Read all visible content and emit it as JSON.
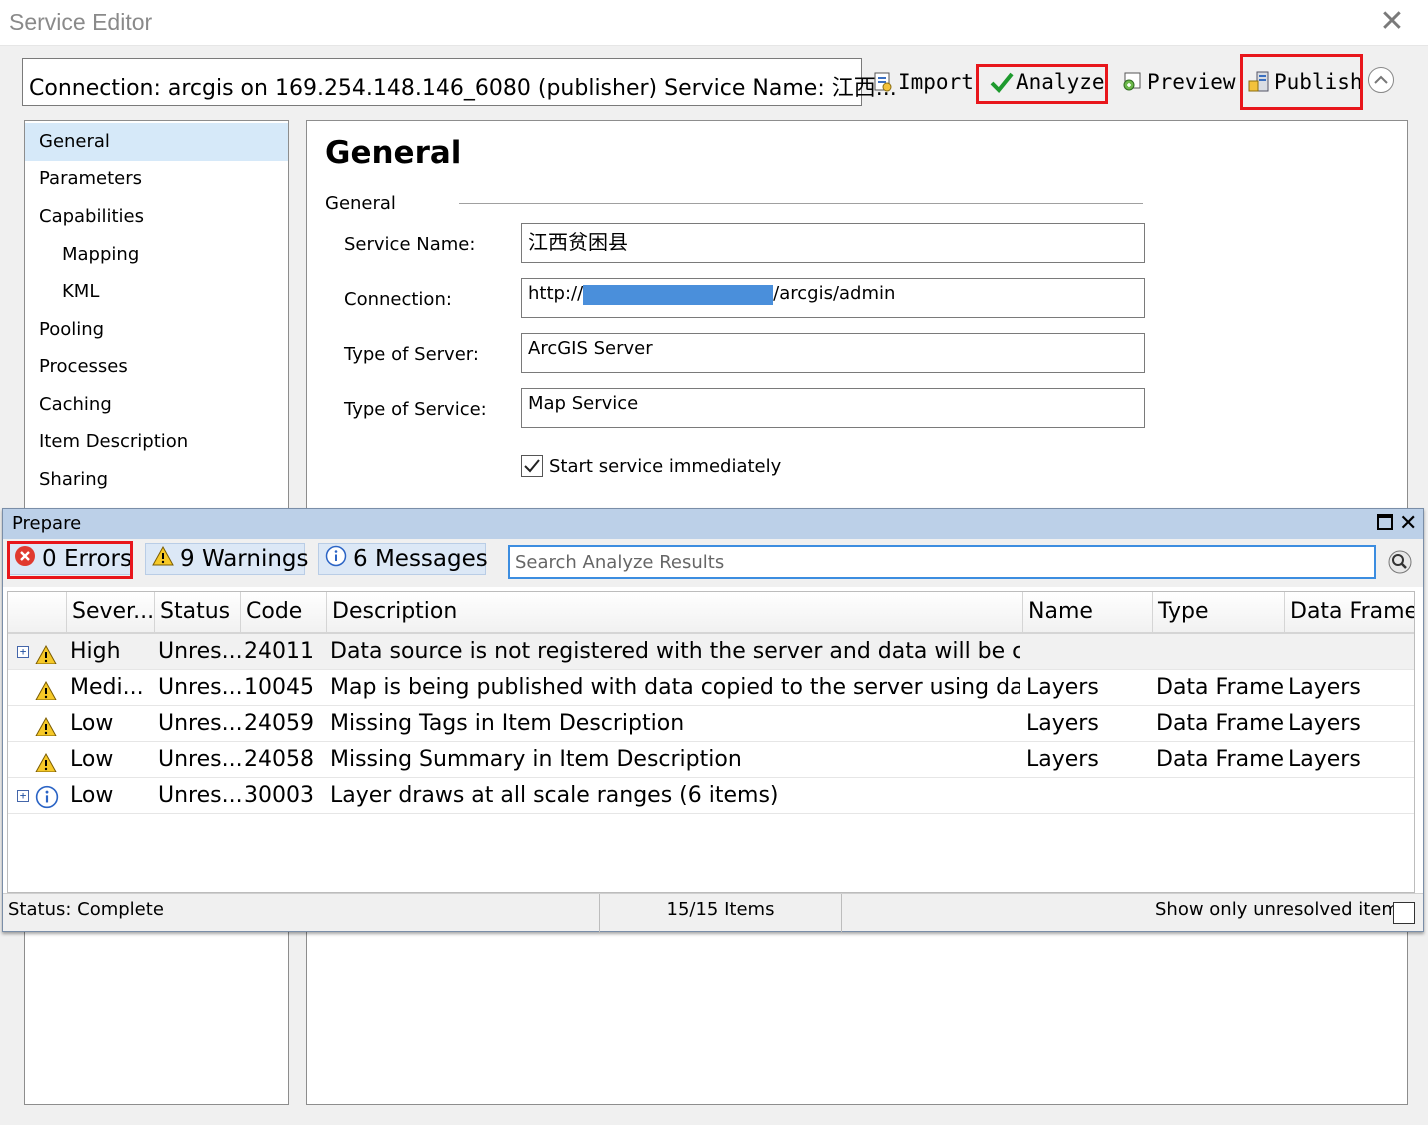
{
  "window": {
    "title": "Service Editor"
  },
  "toolbar": {
    "connection": "Connection: arcgis on 169.254.148.146_6080 (publisher)   Service Name: 江西...",
    "import_label": "Import",
    "analyze_label": "Analyze",
    "preview_label": "Preview",
    "publish_label": "Publish"
  },
  "nav": {
    "items": [
      {
        "label": "General",
        "selected": true,
        "indent": false
      },
      {
        "label": "Parameters",
        "selected": false,
        "indent": false
      },
      {
        "label": "Capabilities",
        "selected": false,
        "indent": false
      },
      {
        "label": "Mapping",
        "selected": false,
        "indent": true
      },
      {
        "label": "KML",
        "selected": false,
        "indent": true
      },
      {
        "label": "Pooling",
        "selected": false,
        "indent": false
      },
      {
        "label": "Processes",
        "selected": false,
        "indent": false
      },
      {
        "label": "Caching",
        "selected": false,
        "indent": false
      },
      {
        "label": "Item Description",
        "selected": false,
        "indent": false
      },
      {
        "label": "Sharing",
        "selected": false,
        "indent": false
      }
    ]
  },
  "general": {
    "heading": "General",
    "group_label": "General",
    "fields": [
      {
        "label": "Service Name:",
        "value": "江西贫困县"
      },
      {
        "label": "Connection:",
        "value_prefix": "http://",
        "value_suffix": "/arcgis/admin"
      },
      {
        "label": "Type of Server:",
        "value": "ArcGIS Server"
      },
      {
        "label": "Type of Service:",
        "value": "Map Service"
      }
    ],
    "start_immediately_label": "Start service immediately",
    "start_immediately_checked": true
  },
  "prepare": {
    "title": "Prepare",
    "errors_label": "0 Errors",
    "warnings_label": "9 Warnings",
    "messages_label": "6 Messages",
    "search_placeholder": "Search Analyze Results",
    "columns": [
      "Sever...",
      "Status",
      "Code",
      "Description",
      "Name",
      "Type",
      "Data Frame"
    ],
    "rows": [
      {
        "icon": "warning",
        "expandable": true,
        "severity": "High",
        "status": "Unres...",
        "code": "24011",
        "description": "Data source is not registered with the server and data will be co...",
        "name": "",
        "type": "",
        "frame": ""
      },
      {
        "icon": "warning",
        "expandable": false,
        "severity": "Medi...",
        "status": "Unres...",
        "code": "10045",
        "description": "Map is being published with data copied to the server using dat...",
        "name": "Layers",
        "type": "Data Frame",
        "frame": "Layers"
      },
      {
        "icon": "warning",
        "expandable": false,
        "severity": "Low",
        "status": "Unres...",
        "code": "24059",
        "description": "Missing Tags in Item Description",
        "name": "Layers",
        "type": "Data Frame",
        "frame": "Layers"
      },
      {
        "icon": "warning",
        "expandable": false,
        "severity": "Low",
        "status": "Unres...",
        "code": "24058",
        "description": "Missing Summary in Item Description",
        "name": "Layers",
        "type": "Data Frame",
        "frame": "Layers"
      },
      {
        "icon": "info",
        "expandable": true,
        "severity": "Low",
        "status": "Unres...",
        "code": "30003",
        "description": "Layer draws at all scale ranges (6 items)",
        "name": "",
        "type": "",
        "frame": ""
      }
    ],
    "status": "Status: Complete",
    "items_count": "15/15 Items",
    "unresolved_label": "Show only unresolved items"
  },
  "colors": {
    "highlight": "#e8161b",
    "selection": "#d6e9f9",
    "titlebar_prepare": "#bcd0e8",
    "redacted": "#4a8fdb"
  }
}
